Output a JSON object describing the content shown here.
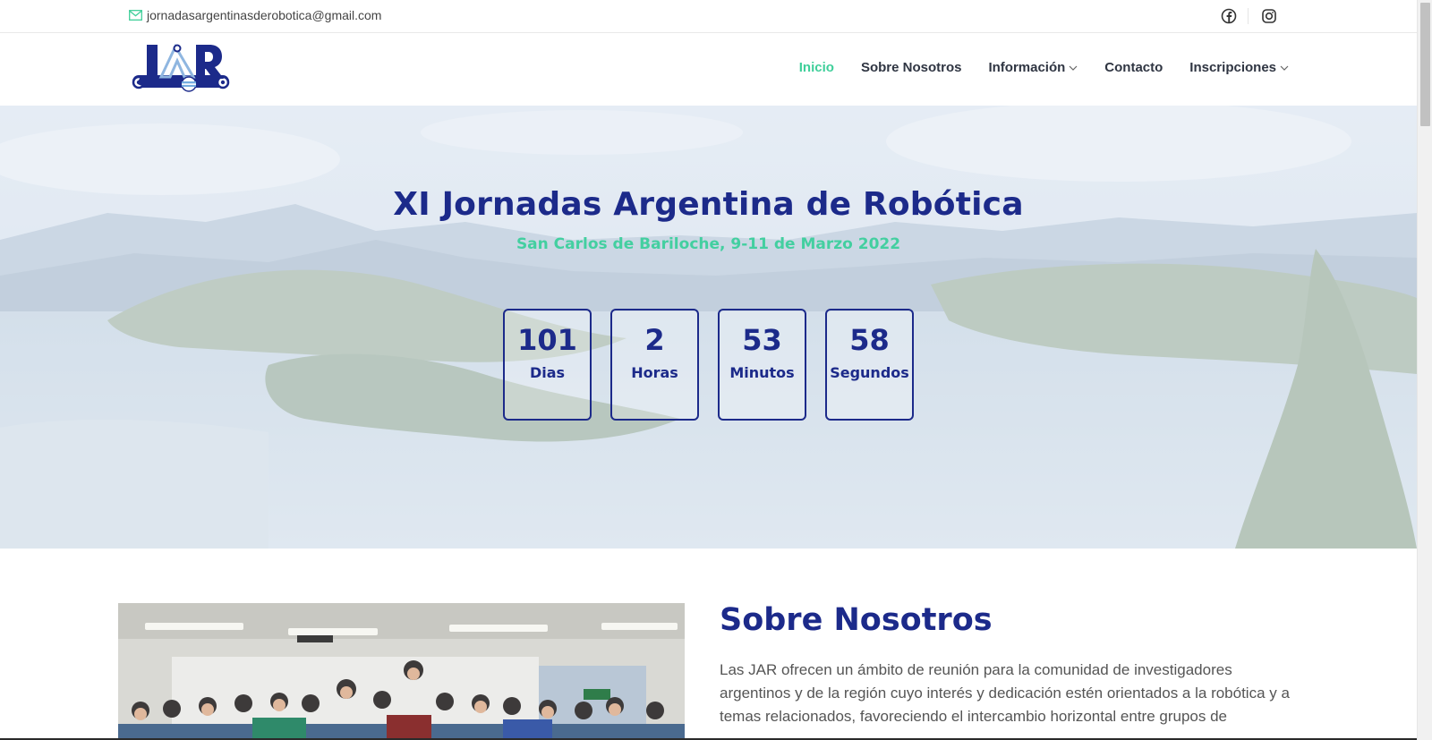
{
  "topbar": {
    "email": "jornadasargentinasderobotica@gmail.com",
    "email_icon": "envelope-icon",
    "social": [
      "facebook-icon",
      "instagram-icon"
    ]
  },
  "header": {
    "logo_alt": "JAR",
    "nav": [
      {
        "label": "Inicio",
        "active": true
      },
      {
        "label": "Sobre Nosotros"
      },
      {
        "label": "Información",
        "dropdown": true
      },
      {
        "label": "Contacto"
      },
      {
        "label": "Inscripciones",
        "dropdown": true
      }
    ]
  },
  "hero": {
    "title": "XI Jornadas Argentina de Robótica",
    "subtitle": "San Carlos de Bariloche, 9-11 de Marzo 2022",
    "countdown": [
      {
        "value": "101",
        "label": "Dias"
      },
      {
        "value": "2",
        "label": "Horas"
      },
      {
        "value": "53",
        "label": "Minutos"
      },
      {
        "value": "58",
        "label": "Segundos"
      }
    ]
  },
  "about": {
    "title": "Sobre Nosotros",
    "text": "Las JAR ofrecen un ámbito de reunión para la comunidad de investigadores argentinos y de la región cuyo interés y dedicación estén orientados a la robótica y a temas relacionados, favoreciendo el intercambio horizontal entre grupos de"
  },
  "colors": {
    "brand": "#1c2a8a",
    "accent": "#43cfa0"
  }
}
